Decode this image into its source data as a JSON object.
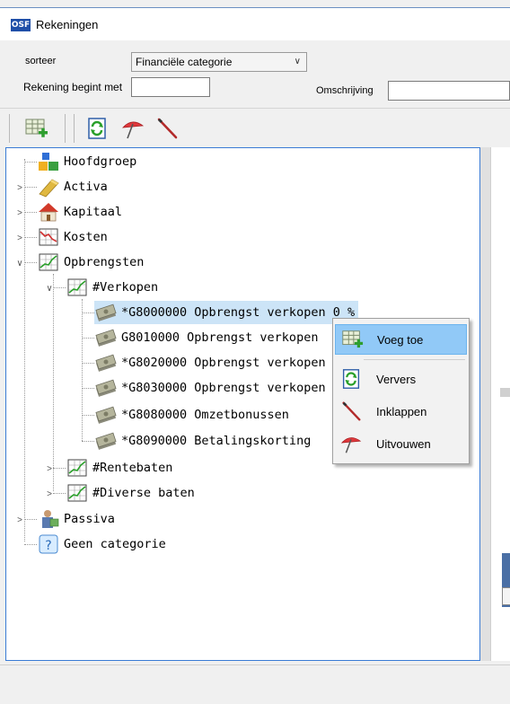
{
  "window": {
    "title": "Rekeningen",
    "app_icon": "OSF"
  },
  "filters": {
    "sort_label": "sorteer",
    "sort_value": "Financiële categorie",
    "starts_with_label": "Rekening begint met",
    "starts_with_value": "",
    "description_label": "Omschrijving",
    "description_value": ""
  },
  "toolbar": {
    "icons": [
      "add-row-icon",
      "refresh-icon",
      "umbrella-icon",
      "wand-icon"
    ]
  },
  "tree": {
    "nodes": [
      {
        "label": "Hoofdgroep",
        "icon": "blocks-icon"
      },
      {
        "label": "Activa",
        "icon": "gold-bar-icon"
      },
      {
        "label": "Kapitaal",
        "icon": "house-icon"
      },
      {
        "label": "Kosten",
        "icon": "chart-down-icon"
      },
      {
        "label": "Opbrengsten",
        "icon": "chart-up-icon"
      },
      {
        "label": "#Verkopen",
        "icon": "chart-up-icon"
      },
      {
        "label": "*G8000000 Opbrengst verkopen 0 %",
        "icon": "money-icon"
      },
      {
        "label": "G8010000 Opbrengst verkopen",
        "icon": "money-icon"
      },
      {
        "label": "*G8020000 Opbrengst verkopen",
        "icon": "money-icon"
      },
      {
        "label": "*G8030000 Opbrengst verkopen",
        "icon": "money-icon"
      },
      {
        "label": "*G8080000 Omzetbonussen",
        "icon": "money-icon"
      },
      {
        "label": "*G8090000 Betalingskorting",
        "icon": "money-icon"
      },
      {
        "label": "#Rentebaten",
        "icon": "chart-up-icon"
      },
      {
        "label": "#Diverse baten",
        "icon": "chart-up-icon"
      },
      {
        "label": "Passiva",
        "icon": "person-icon"
      },
      {
        "label": "Geen categorie",
        "icon": "question-icon"
      }
    ]
  },
  "context_menu": {
    "items": [
      {
        "label": "Voeg toe",
        "icon": "add-row-icon"
      },
      {
        "label": "Ververs",
        "icon": "refresh-icon"
      },
      {
        "label": "Inklappen",
        "icon": "wand-icon"
      },
      {
        "label": "Uitvouwen",
        "icon": "umbrella-icon"
      }
    ]
  },
  "colors": {
    "selection": "#cce4f7",
    "menu_highlight": "#91c9f7",
    "tree_border": "#3a7bd5"
  }
}
